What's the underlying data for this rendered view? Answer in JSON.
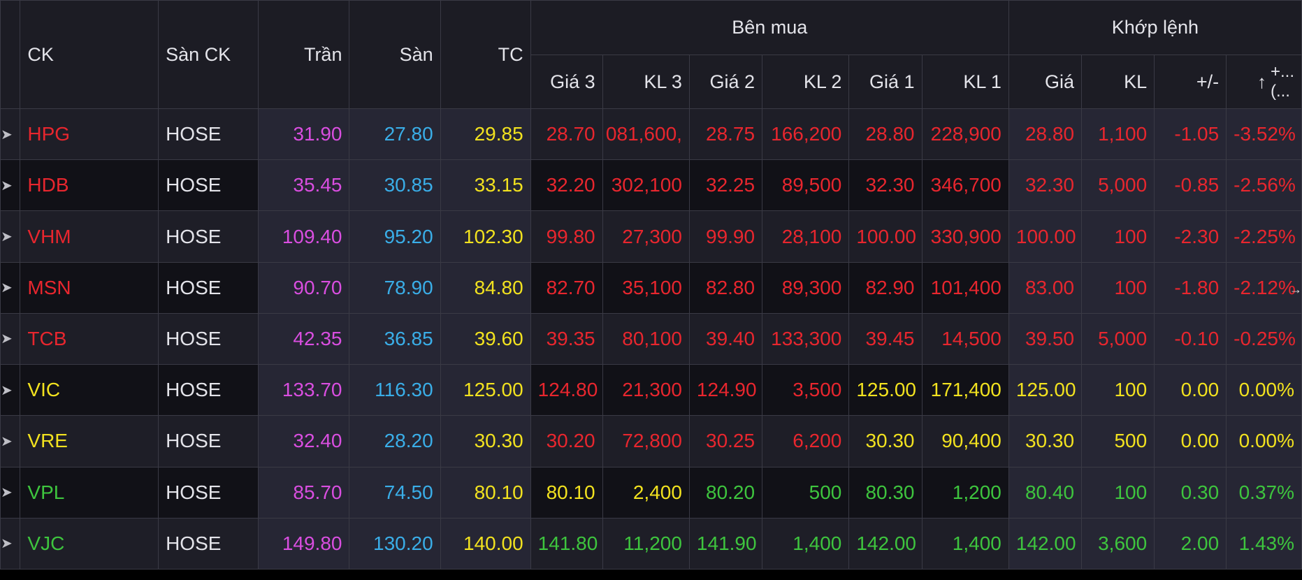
{
  "headers": {
    "ck": "CK",
    "san_ck": "Sàn CK",
    "tran": "Trần",
    "san": "Sàn",
    "tc": "TC",
    "ben_mua": "Bên mua",
    "khop_lenh": "Khớp lệnh",
    "gia3": "Giá 3",
    "kl3": "KL 3",
    "gia2": "Giá 2",
    "kl2": "KL 2",
    "gia1": "Giá 1",
    "kl1": "KL 1",
    "gia": "Giá",
    "kl": "KL",
    "change": "+/-",
    "pct_arrow": "↑",
    "pct_line1": "+...",
    "pct_line2": "(..."
  },
  "colors": {
    "red": "#e8262e",
    "yellow": "#f2e21f",
    "green": "#3ec53e",
    "ceiling": "#d94ee0",
    "floor": "#3aaee8",
    "ref": "#f2e21f",
    "white": "#e4e4ea"
  },
  "rows": [
    {
      "ck": "HPG",
      "exch": "HOSE",
      "tran": "31.90",
      "san": "27.80",
      "tc": "29.85",
      "g3": "28.70",
      "kl3": ",081,600",
      "g2": "28.75",
      "kl2": "166,200",
      "g1": "28.80",
      "kl1": "228,900",
      "gia": "28.80",
      "kl": "1,100",
      "chg": "-1.05",
      "pct": "-3.52%",
      "c_ck": "red",
      "c3": "red",
      "c2": "red",
      "c1": "red",
      "cm": "red"
    },
    {
      "ck": "HDB",
      "exch": "HOSE",
      "tran": "35.45",
      "san": "30.85",
      "tc": "33.15",
      "g3": "32.20",
      "kl3": "302,100",
      "g2": "32.25",
      "kl2": "89,500",
      "g1": "32.30",
      "kl1": "346,700",
      "gia": "32.30",
      "kl": "5,000",
      "chg": "-0.85",
      "pct": "-2.56%",
      "c_ck": "red",
      "c3": "red",
      "c2": "red",
      "c1": "red",
      "cm": "red"
    },
    {
      "ck": "VHM",
      "exch": "HOSE",
      "tran": "109.40",
      "san": "95.20",
      "tc": "102.30",
      "g3": "99.80",
      "kl3": "27,300",
      "g2": "99.90",
      "kl2": "28,100",
      "g1": "100.00",
      "kl1": "330,900",
      "gia": "100.00",
      "kl": "100",
      "chg": "-2.30",
      "pct": "-2.25%",
      "c_ck": "red",
      "c3": "red",
      "c2": "red",
      "c1": "red",
      "cm": "red"
    },
    {
      "ck": "MSN",
      "exch": "HOSE",
      "tran": "90.70",
      "san": "78.90",
      "tc": "84.80",
      "g3": "82.70",
      "kl3": "35,100",
      "g2": "82.80",
      "kl2": "89,300",
      "g1": "82.90",
      "kl1": "101,400",
      "gia": "83.00",
      "kl": "100",
      "chg": "-1.80",
      "pct": "-2.12%",
      "c_ck": "red",
      "c3": "red",
      "c2": "red",
      "c1": "red",
      "cm": "red"
    },
    {
      "ck": "TCB",
      "exch": "HOSE",
      "tran": "42.35",
      "san": "36.85",
      "tc": "39.60",
      "g3": "39.35",
      "kl3": "80,100",
      "g2": "39.40",
      "kl2": "133,300",
      "g1": "39.45",
      "kl1": "14,500",
      "gia": "39.50",
      "kl": "5,000",
      "chg": "-0.10",
      "pct": "-0.25%",
      "c_ck": "red",
      "c3": "red",
      "c2": "red",
      "c1": "red",
      "cm": "red"
    },
    {
      "ck": "VIC",
      "exch": "HOSE",
      "tran": "133.70",
      "san": "116.30",
      "tc": "125.00",
      "g3": "124.80",
      "kl3": "21,300",
      "g2": "124.90",
      "kl2": "3,500",
      "g1": "125.00",
      "kl1": "171,400",
      "gia": "125.00",
      "kl": "100",
      "chg": "0.00",
      "pct": "0.00%",
      "c_ck": "yellow",
      "c3": "red",
      "c2": "red",
      "c1": "yellow",
      "cm": "yellow"
    },
    {
      "ck": "VRE",
      "exch": "HOSE",
      "tran": "32.40",
      "san": "28.20",
      "tc": "30.30",
      "g3": "30.20",
      "kl3": "72,800",
      "g2": "30.25",
      "kl2": "6,200",
      "g1": "30.30",
      "kl1": "90,400",
      "gia": "30.30",
      "kl": "500",
      "chg": "0.00",
      "pct": "0.00%",
      "c_ck": "yellow",
      "c3": "red",
      "c2": "red",
      "c1": "yellow",
      "cm": "yellow"
    },
    {
      "ck": "VPL",
      "exch": "HOSE",
      "tran": "85.70",
      "san": "74.50",
      "tc": "80.10",
      "g3": "80.10",
      "kl3": "2,400",
      "g2": "80.20",
      "kl2": "500",
      "g1": "80.30",
      "kl1": "1,200",
      "gia": "80.40",
      "kl": "100",
      "chg": "0.30",
      "pct": "0.37%",
      "c_ck": "green",
      "c3": "yellow",
      "c2": "green",
      "c1": "green",
      "cm": "green"
    },
    {
      "ck": "VJC",
      "exch": "HOSE",
      "tran": "149.80",
      "san": "130.20",
      "tc": "140.00",
      "g3": "141.80",
      "kl3": "11,200",
      "g2": "141.90",
      "kl2": "1,400",
      "g1": "142.00",
      "kl1": "1,400",
      "gia": "142.00",
      "kl": "3,600",
      "chg": "2.00",
      "pct": "1.43%",
      "c_ck": "green",
      "c3": "green",
      "c2": "green",
      "c1": "green",
      "cm": "green"
    }
  ],
  "side_arrow": "→"
}
